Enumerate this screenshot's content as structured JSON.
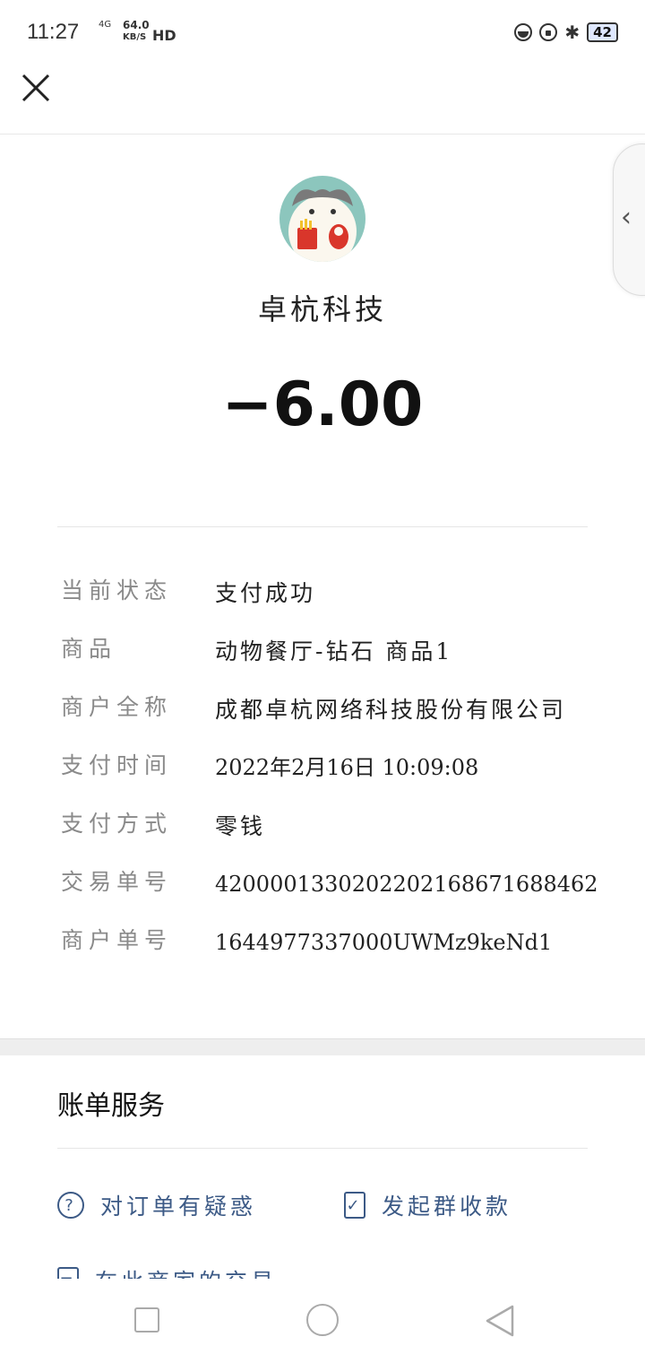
{
  "status_bar": {
    "time": "11:27",
    "network": "4G",
    "speed_value": "64.0",
    "speed_unit": "KB/S",
    "hd": "HD",
    "battery": "42"
  },
  "header": {
    "close_icon": "close-icon",
    "side_tab_icon": "chevron-left-icon"
  },
  "merchant": {
    "name": "卓杭科技",
    "amount": "−6.00"
  },
  "details": [
    {
      "label": "当前状态",
      "value": "支付成功"
    },
    {
      "label": "商品",
      "value": "动物餐厅-钻石 商品1"
    },
    {
      "label": "商户全称",
      "value": "成都卓杭网络科技股份有限公司"
    },
    {
      "label": "支付时间",
      "value": "2022年2月16日 10:09:08"
    },
    {
      "label": "支付方式",
      "value": "零钱"
    },
    {
      "label": "交易单号",
      "value": "4200001330202202168671688462"
    },
    {
      "label": "商户单号",
      "value": "1644977337000UWMz9keNd1"
    }
  ],
  "services": {
    "title": "账单服务",
    "items": [
      {
        "label": "对订单有疑惑",
        "icon": "question-circle-icon"
      },
      {
        "label": "发起群收款",
        "icon": "checklist-icon"
      },
      {
        "label": "在此商家的交易",
        "icon": "list-icon"
      }
    ]
  },
  "nav": {
    "recent": "square-icon",
    "home": "circle-icon",
    "back": "triangle-back-icon"
  },
  "colors": {
    "link": "#3c5a86",
    "label_gray": "#8a8a8a",
    "avatar_bg": "#8cc6bd"
  }
}
